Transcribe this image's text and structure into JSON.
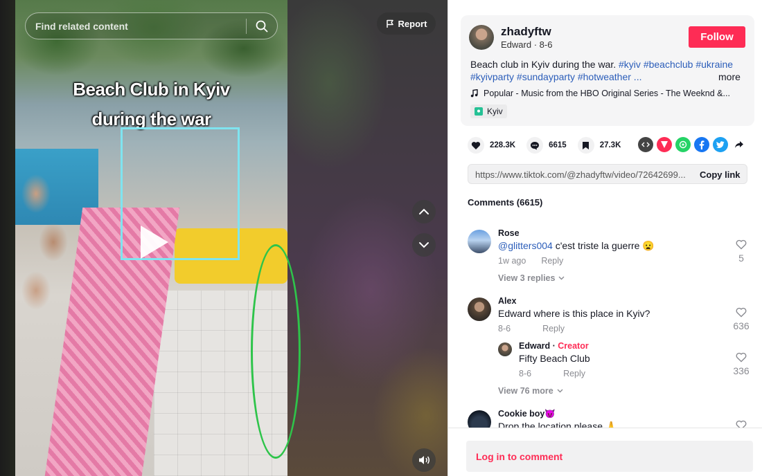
{
  "search": {
    "placeholder": "Find related content"
  },
  "report": {
    "label": "Report"
  },
  "video": {
    "caption_line1": "Beach Club in Kyiv",
    "caption_line2": "during the war"
  },
  "author": {
    "username": "zhadyftw",
    "display_name": "Edward",
    "date": "8-6",
    "follow_label": "Follow"
  },
  "description": {
    "text": "Beach club in Kyiv during the war.",
    "tags_line1": [
      "#kyiv",
      "#beachclub",
      "#ukraine"
    ],
    "tags_line2": "#kyivparty #sundayparty #hotweather ...",
    "more": "more"
  },
  "music": "Popular - Music from the HBO Original Series - The Weeknd &...",
  "location": "Kyiv",
  "stats": {
    "likes": "228.3K",
    "comments": "6615",
    "saves": "27.3K"
  },
  "share": {
    "icons": [
      "embed-icon",
      "send-icon",
      "whatsapp-icon",
      "facebook-icon",
      "twitter-icon",
      "share-arrow-icon"
    ],
    "colors": {
      "send": "#fe2c55",
      "whatsapp": "#25d366",
      "facebook": "#1877f2",
      "twitter": "#1da1f2",
      "embed": "#444444"
    }
  },
  "link": {
    "url": "https://www.tiktok.com/@zhadyftw/video/72642699...",
    "copy_label": "Copy link"
  },
  "comments": {
    "header": "Comments (6615)",
    "items": [
      {
        "name": "Rose",
        "mention": "@glitters004",
        "text": " c'est triste la guerre 😦",
        "time": "1w ago",
        "reply": "Reply",
        "likes": "5",
        "view_replies": "View 3 replies"
      },
      {
        "name": "Alex",
        "text": "Edward where is this place in Kyiv?",
        "time": "8-6",
        "reply": "Reply",
        "likes": "636"
      },
      {
        "name": "Edward",
        "badge": "Creator",
        "text": "Fifty Beach Club",
        "time": "8-6",
        "reply": "Reply",
        "likes": "336",
        "view_replies": "View 76 more"
      },
      {
        "name": "Cookie boy😈",
        "text": "Drop the location please 🙏"
      }
    ]
  },
  "login": {
    "label": "Log in to comment"
  },
  "colors": {
    "brand": "#fe2c55",
    "link": "#2b5db9",
    "accent_cyan": "#7fe4f0",
    "accent_green": "#2ec44a"
  }
}
